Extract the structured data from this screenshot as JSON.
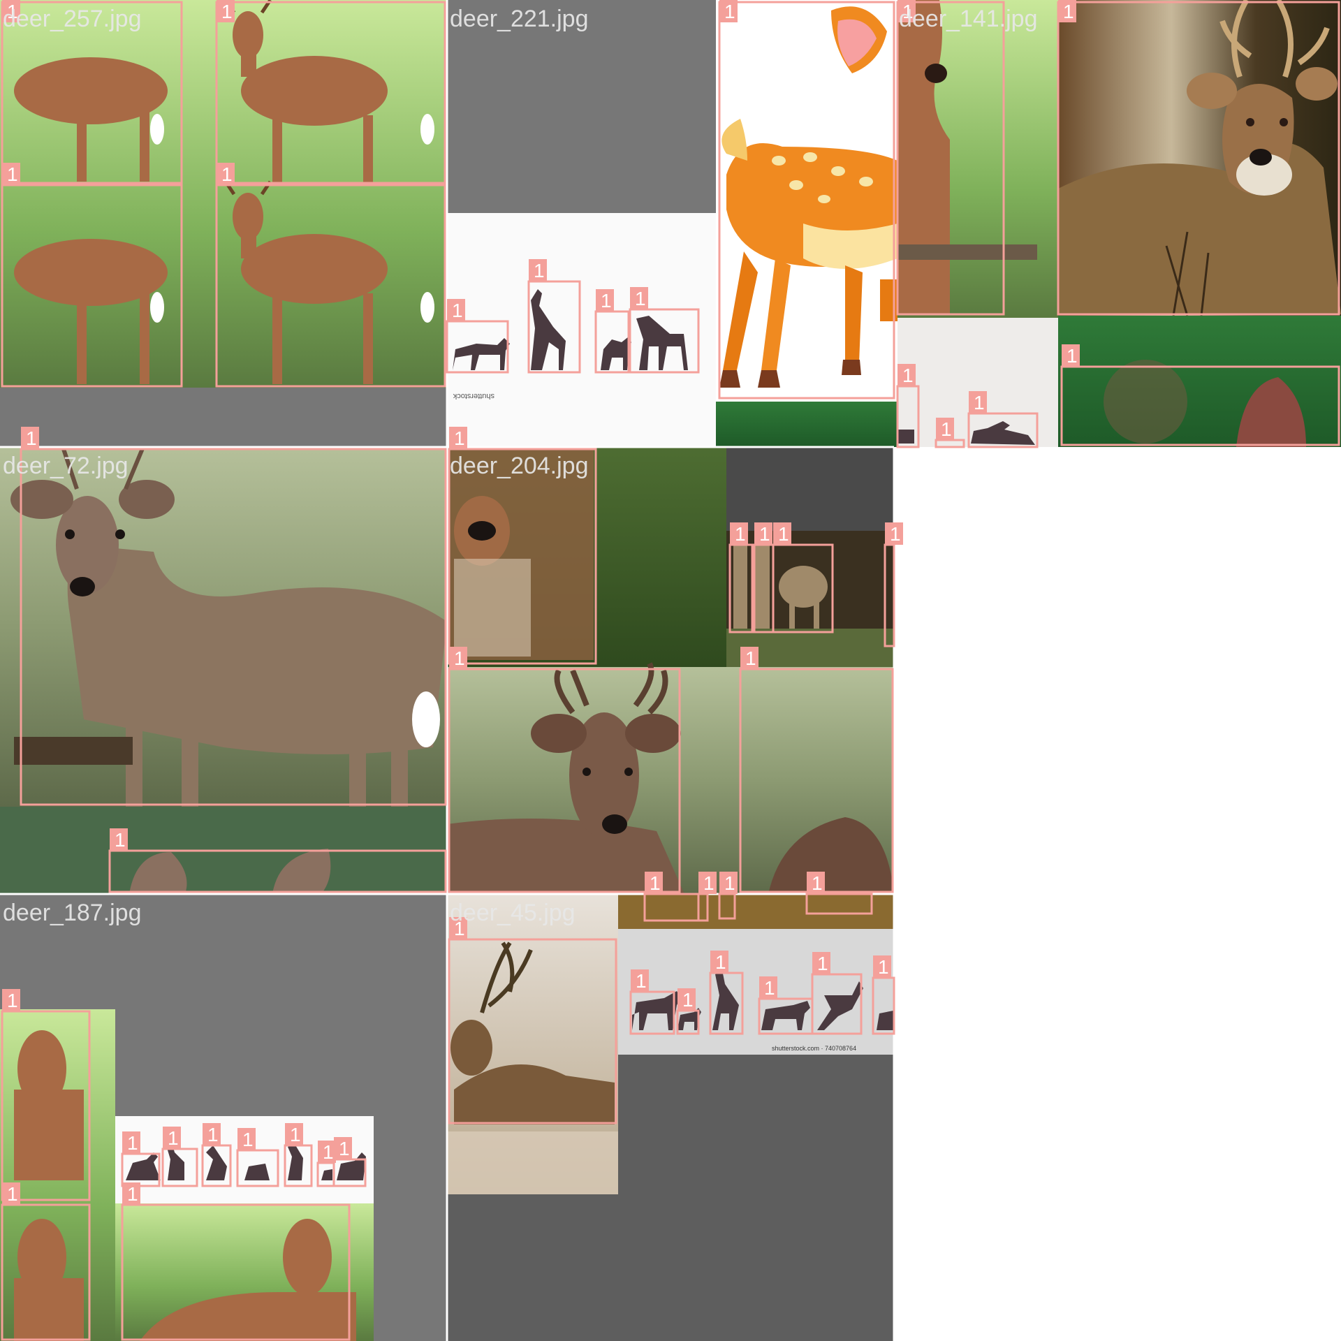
{
  "tile_names": [
    "deer_257.jpg",
    "deer_221.jpg",
    "deer_141.jpg",
    "deer_72.jpg",
    "deer_204.jpg",
    "deer_187.jpg",
    "deer_45.jpg"
  ],
  "box_class": "1",
  "colors": {
    "box": "#f4a09a",
    "box_tag": "#f4a09a",
    "tag_text": "#ffffff",
    "filename_text": "#e8e8e8",
    "letterbox_gray": "#727272",
    "dark_letterbox": "#5e5e5e",
    "background": "#ffffff"
  },
  "watermark_texts": [
    "shutterstock",
    "shutterstock.com · 740708764"
  ]
}
